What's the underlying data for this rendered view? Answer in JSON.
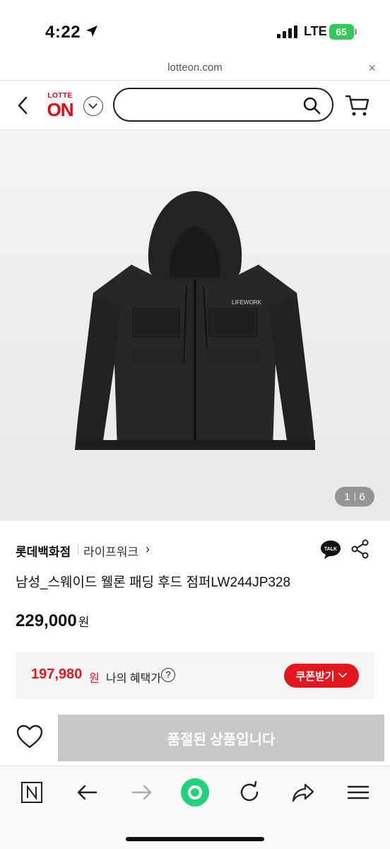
{
  "status_bar": {
    "time": "4:22",
    "network": "LTE",
    "battery": "65"
  },
  "url_bar": {
    "url": "lotteon.com",
    "close_label": "×"
  },
  "header": {
    "logo_top": "LOTTE",
    "logo_main": "ON",
    "search_placeholder": ""
  },
  "hero": {
    "current": "1",
    "total": "6",
    "image": "black hooded jacket"
  },
  "product": {
    "brand": "롯데백화점",
    "sub_brand": "라이프워크",
    "sub_chevron": "›",
    "talk_label": "TALK",
    "title": "남성_스웨이드 웰론 패딩 후드 점퍼LW244JP328",
    "price": "229,000",
    "price_unit": "원"
  },
  "benefit": {
    "price": "197,980",
    "unit": "원",
    "label": "나의 혜택가",
    "help": "?",
    "coupon_label": "쿠폰받기"
  },
  "actions": {
    "soldout_label": "품절된 상품입니다"
  },
  "colors": {
    "accent_red": "#e4171e",
    "soldout_gray": "#c7c7c7",
    "toolbar_green": "#22d27a"
  }
}
